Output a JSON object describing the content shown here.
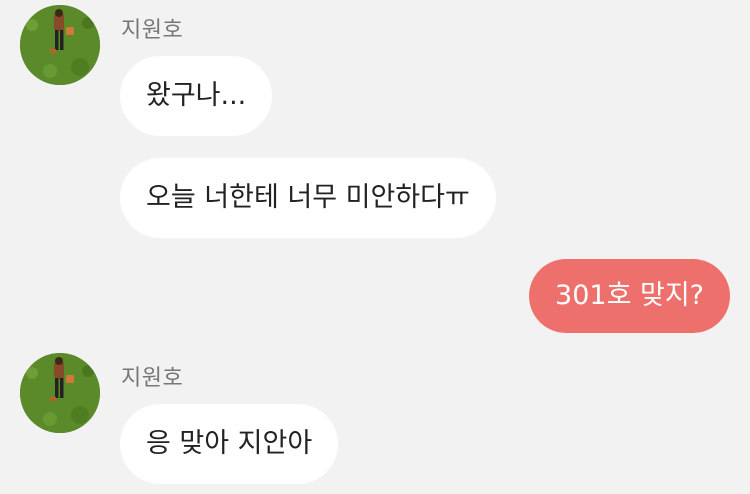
{
  "chat": {
    "groups": [
      {
        "sender": "지원호",
        "messages": [
          "왔구나...",
          "오늘 너한테 너무 미안하다ㅠ"
        ]
      },
      {
        "sent": [
          "301호 맞지?"
        ]
      },
      {
        "sender": "지원호",
        "messages": [
          "응 맞아 지안아"
        ]
      }
    ]
  },
  "colors": {
    "background": "#f2f2f2",
    "received_bubble": "#ffffff",
    "sent_bubble": "#ee706d",
    "sender_name": "#777777"
  },
  "icons": {
    "avatar": "profile-photo-person-on-grass"
  }
}
